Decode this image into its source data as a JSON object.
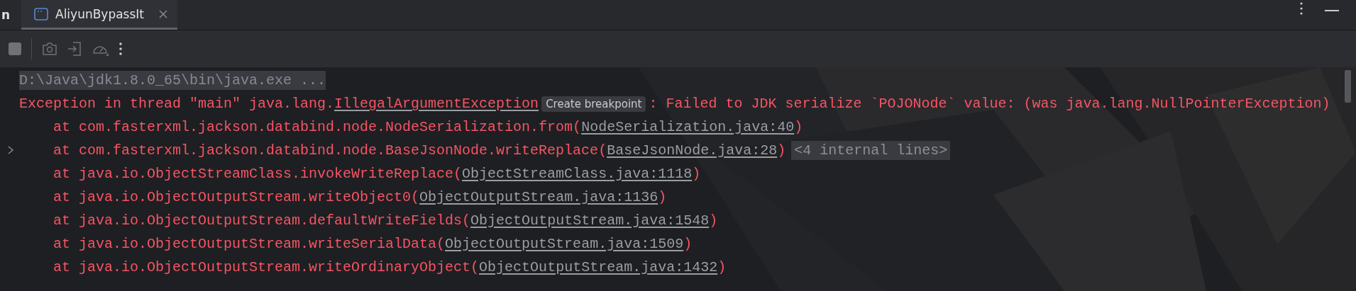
{
  "tab_bar": {
    "cut_label": "n",
    "tabs": [
      {
        "label": "AliyunBypassIt",
        "selected": true
      }
    ]
  },
  "console": {
    "command": "D:\\Java\\jdk1.8.0_65\\bin\\java.exe ...",
    "exception": {
      "prefix": "Exception in thread \"main\" java.lang.",
      "class_link": "IllegalArgumentException",
      "hint": "Create breakpoint",
      "message": ": Failed to JDK serialize `POJONode` value: (was java.lang.NullPointerException)"
    },
    "frames": [
      {
        "call": "at com.fasterxml.jackson.databind.node.NodeSerialization.from(",
        "link": "NodeSerialization.java:40",
        "close": ")"
      },
      {
        "call": "at com.fasterxml.jackson.databind.node.BaseJsonNode.writeReplace(",
        "link": "BaseJsonNode.java:28",
        "close": ")",
        "folded": "<4 internal lines>",
        "expanded": false
      },
      {
        "call": "at java.io.ObjectStreamClass.invokeWriteReplace(",
        "link": "ObjectStreamClass.java:1118",
        "close": ")"
      },
      {
        "call": "at java.io.ObjectOutputStream.writeObject0(",
        "link": "ObjectOutputStream.java:1136",
        "close": ")"
      },
      {
        "call": "at java.io.ObjectOutputStream.defaultWriteFields(",
        "link": "ObjectOutputStream.java:1548",
        "close": ")"
      },
      {
        "call": "at java.io.ObjectOutputStream.writeSerialData(",
        "link": "ObjectOutputStream.java:1509",
        "close": ")"
      },
      {
        "call": "at java.io.ObjectOutputStream.writeOrdinaryObject(",
        "link": "ObjectOutputStream.java:1432",
        "close": ")"
      }
    ]
  }
}
